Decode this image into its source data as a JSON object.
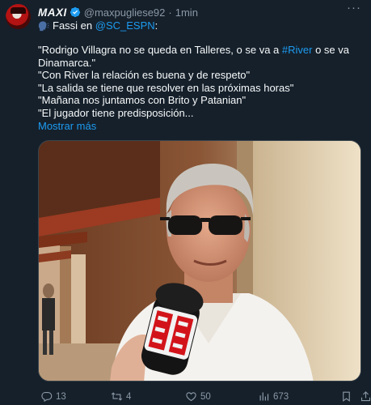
{
  "author": {
    "display_name": "MAXI",
    "handle": "@maxpugliese92",
    "separator": "·",
    "time": "1min"
  },
  "intro": {
    "speaker_icon": "speaking-head-icon",
    "prefix": "Fassi en",
    "mention": "@SC_ESPN",
    "suffix": ":"
  },
  "body": {
    "p1_a": "\"Rodrigo Villagra no se queda en Talleres, o se va a ",
    "p1_link": "#River",
    "p1_b": " o se va Dinamarca.\"",
    "p2": "\"Con River la relación es buena y de respeto\"",
    "p3": "\"La salida se tiene que resolver en las próximas horas\"",
    "p4": "\"Mañana nos juntamos con Brito y Patanian\"",
    "p5": "\"El jugador tiene predisposición..."
  },
  "show_more": "Mostrar más",
  "media": {
    "microphone_brand": "ESPN",
    "icon": "video-still-image"
  },
  "actions": {
    "replies": "13",
    "retweets": "4",
    "likes": "50",
    "views": "673"
  },
  "colors": {
    "background": "#15202b",
    "text": "#f7f9f9",
    "muted": "#8b98a5",
    "link": "#1d9bf0",
    "espn_red": "#d2141a"
  }
}
